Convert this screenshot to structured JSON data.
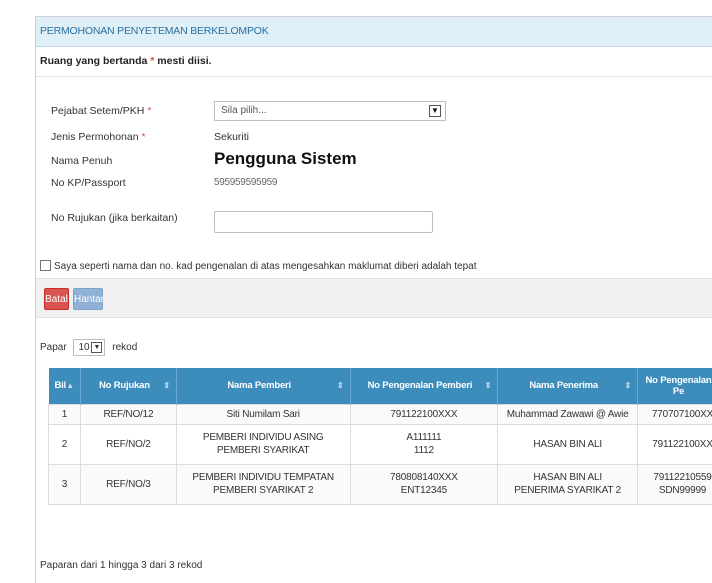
{
  "panel": {
    "title": "PERMOHONAN PENYETEMAN BERKELOMPOK",
    "required_note_prefix": "Ruang yang bertanda ",
    "required_star": "*",
    "required_note_suffix": " mesti diisi."
  },
  "form": {
    "pejabat_label": "Pejabat Setem/PKH",
    "pejabat_placeholder": "Sila pilih...",
    "jenis_label": "Jenis Permohonan",
    "jenis_value": "Sekuriti",
    "nama_label": "Nama Penuh",
    "nama_value": "Pengguna Sistem",
    "kp_label": "No KP/Passport",
    "kp_value": "595959595959",
    "rujukan_label": "No Rujukan (jika berkaitan)",
    "rujukan_value": "",
    "star": "*"
  },
  "declaration": "Saya seperti nama dan no. kad pengenalan di atas mengesahkan maklumat diberi adalah tepat",
  "buttons": {
    "batal": "Batal",
    "hantar": "Hantar"
  },
  "paging": {
    "prefix": "Papar",
    "value": "10",
    "suffix": "rekod"
  },
  "table": {
    "headers": [
      "Bil",
      "No Rujukan",
      "Nama Pemberi",
      "No Pengenalan Pemberi",
      "Nama Penerima",
      "No Pengenalan Pe"
    ],
    "rows": [
      {
        "bil": "1",
        "rujukan": "REF/NO/12",
        "pemberi_1": "Siti Numilam Sari",
        "pemberi_2": "",
        "id_pemberi_1": "791122100XXX",
        "id_pemberi_2": "",
        "penerima_1": "Muhammad Zawawi @ Awie",
        "penerima_2": "",
        "id_penerima_1": "770707100XX",
        "id_penerima_2": ""
      },
      {
        "bil": "2",
        "rujukan": "REF/NO/2",
        "pemberi_1": "PEMBERI INDIVIDU ASING",
        "pemberi_2": "PEMBERI SYARIKAT",
        "id_pemberi_1": "A111111",
        "id_pemberi_2": "1112",
        "penerima_1": "HASAN BIN ALI",
        "penerima_2": "",
        "id_penerima_1": "791122100XX",
        "id_penerima_2": ""
      },
      {
        "bil": "3",
        "rujukan": "REF/NO/3",
        "pemberi_1": "PEMBERI INDIVIDU TEMPATAN",
        "pemberi_2": "PEMBERI SYARIKAT 2",
        "id_pemberi_1": "780808140XXX",
        "id_pemberi_2": "ENT12345",
        "penerima_1": "HASAN BIN ALI",
        "penerima_2": "PENERIMA SYARIKAT 2",
        "id_penerima_1": "79112210559",
        "id_penerima_2": "SDN99999"
      }
    ]
  },
  "footer": "Paparan dari 1 hingga 3 dari 3 rekod",
  "colors": {
    "header_bg": "#3c8dbc",
    "batal": "#d9534f",
    "hantar": "#8fb1d6",
    "panel_head": "#dfeff8"
  }
}
